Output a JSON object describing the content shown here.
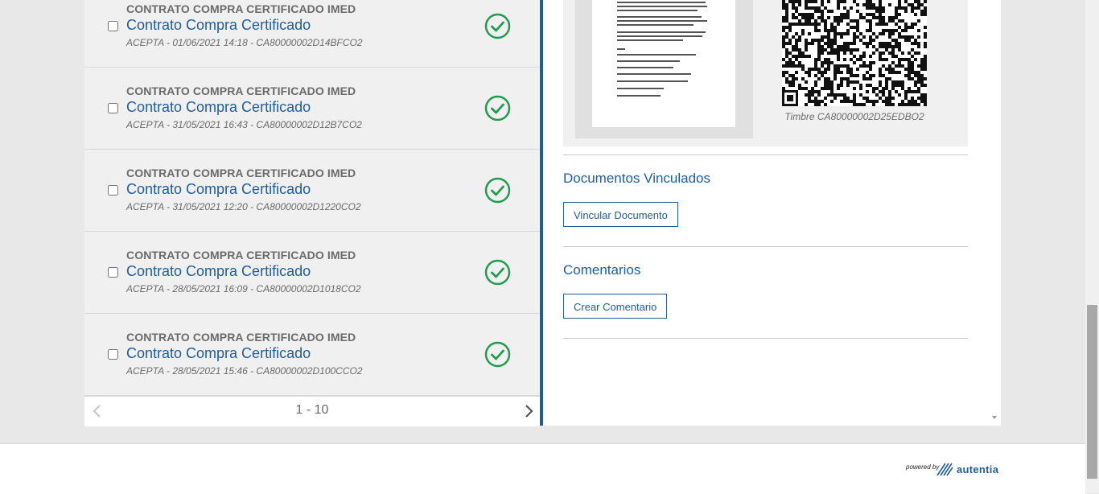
{
  "documents": [
    {
      "type": "CONTRATO COMPRA CERTIFICADO IMED",
      "title": "Contrato Compra Certificado",
      "meta": "ACEPTA - 01/06/2021 14:18 - CA80000002D14BFCO2",
      "status_icon": "check-circle-icon"
    },
    {
      "type": "CONTRATO COMPRA CERTIFICADO IMED",
      "title": "Contrato Compra Certificado",
      "meta": "ACEPTA - 31/05/2021 16:43 - CA80000002D12B7CO2",
      "status_icon": "check-circle-icon"
    },
    {
      "type": "CONTRATO COMPRA CERTIFICADO IMED",
      "title": "Contrato Compra Certificado",
      "meta": "ACEPTA - 31/05/2021 12:20 - CA80000002D1220CO2",
      "status_icon": "check-circle-icon"
    },
    {
      "type": "CONTRATO COMPRA CERTIFICADO IMED",
      "title": "Contrato Compra Certificado",
      "meta": "ACEPTA - 28/05/2021 16:09 - CA80000002D1018CO2",
      "status_icon": "check-circle-icon"
    },
    {
      "type": "CONTRATO COMPRA CERTIFICADO IMED",
      "title": "Contrato Compra Certificado",
      "meta": "ACEPTA - 28/05/2021 15:46 - CA80000002D100CCO2",
      "status_icon": "check-circle-icon"
    }
  ],
  "pager": {
    "range": "1 - 10",
    "prev_icon": "chevron-left-icon",
    "next_icon": "chevron-right-icon"
  },
  "preview": {
    "timbre": "Timbre CA80000002D25EDBO2"
  },
  "linked_docs": {
    "title": "Documentos Vinculados",
    "button": "Vincular Documento"
  },
  "comments": {
    "title": "Comentarios",
    "button": "Crear Comentario"
  },
  "footer": {
    "powered": "powered by",
    "brand": "autentia",
    "brand_icon": "autentia-logo-icon"
  },
  "colors": {
    "accent": "#1f5d9c",
    "success": "#1e9e4c",
    "panel": "#f0f0f0",
    "muted": "#6a6a6a"
  }
}
